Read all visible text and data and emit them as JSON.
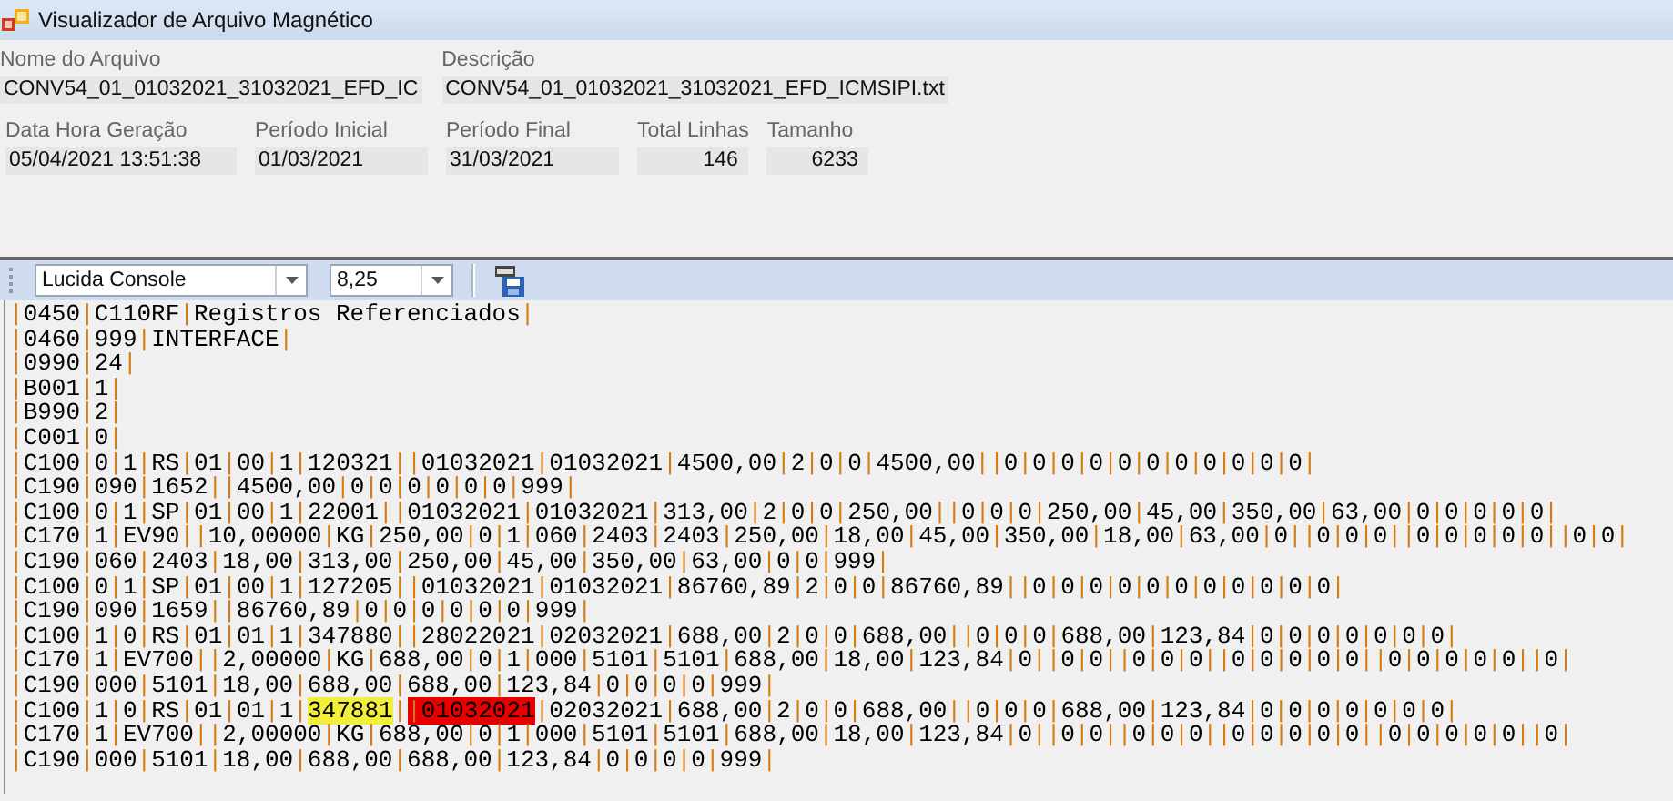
{
  "window": {
    "title": "Visualizador de Arquivo Magnético"
  },
  "file_fields": [
    {
      "label": "Nome do Arquivo",
      "value": "CONV54_01_01032021_31032021_EFD_IC"
    },
    {
      "label": "Descrição",
      "value": "CONV54_01_01032021_31032021_EFD_ICMSIPI.txt"
    }
  ],
  "summary_fields": [
    {
      "label": "Data Hora Geração",
      "value": "05/04/2021 13:51:38",
      "kind": "text"
    },
    {
      "label": "Período Inicial",
      "value": "01/03/2021",
      "kind": "text"
    },
    {
      "label": "Período Final",
      "value": "31/03/2021",
      "kind": "text"
    },
    {
      "label": "Total Linhas",
      "value": "146",
      "kind": "number"
    },
    {
      "label": "Tamanho",
      "value": "6233",
      "kind": "number"
    }
  ],
  "toolbar": {
    "font": "Lucida Console",
    "size": "8,25"
  },
  "lines": [
    {
      "segments": [
        {
          "text": "|0450|C110RF|Registros Referenciados|"
        }
      ]
    },
    {
      "segments": [
        {
          "text": "|0460|999|INTERFACE|"
        }
      ]
    },
    {
      "segments": [
        {
          "text": "|0990|24|"
        }
      ]
    },
    {
      "segments": [
        {
          "text": "|B001|1|"
        }
      ]
    },
    {
      "segments": [
        {
          "text": "|B990|2|"
        }
      ]
    },
    {
      "segments": [
        {
          "text": "|C001|0|"
        }
      ]
    },
    {
      "segments": [
        {
          "text": "|C100|0|1|RS|01|00|1|120321||01032021|01032021|4500,00|2|0|0|4500,00||0|0|0|0|0|0|0|0|0|0|0|"
        }
      ]
    },
    {
      "segments": [
        {
          "text": "|C190|090|1652||4500,00|0|0|0|0|0|0|999|"
        }
      ]
    },
    {
      "segments": [
        {
          "text": "|C100|0|1|SP|01|00|1|22001||01032021|01032021|313,00|2|0|0|250,00||0|0|0|250,00|45,00|350,00|63,00|0|0|0|0|0|"
        }
      ]
    },
    {
      "segments": [
        {
          "text": "|C170|1|EV90||10,00000|KG|250,00|0|1|060|2403|2403|250,00|18,00|45,00|350,00|18,00|63,00|0||0|0|0||0|0|0|0|0||0|0|"
        }
      ]
    },
    {
      "segments": [
        {
          "text": "|C190|060|2403|18,00|313,00|250,00|45,00|350,00|63,00|0|0|999|"
        }
      ]
    },
    {
      "segments": [
        {
          "text": "|C100|0|1|SP|01|00|1|127205||01032021|01032021|86760,89|2|0|0|86760,89||0|0|0|0|0|0|0|0|0|0|0|"
        }
      ]
    },
    {
      "segments": [
        {
          "text": "|C190|090|1659||86760,89|0|0|0|0|0|0|999|"
        }
      ]
    },
    {
      "segments": [
        {
          "text": "|C100|1|0|RS|01|01|1|347880||28022021|02032021|688,00|2|0|0|688,00||0|0|0|688,00|123,84|0|0|0|0|0|0|0|"
        }
      ]
    },
    {
      "segments": [
        {
          "text": "|C170|1|EV700||2,00000|KG|688,00|0|1|000|5101|5101|688,00|18,00|123,84|0||0|0||0|0|0||0|0|0|0|0||0|0|0|0|0||0|"
        }
      ]
    },
    {
      "segments": [
        {
          "text": "|C190|000|5101|18,00|688,00|688,00|123,84|0|0|0|0|999|"
        }
      ]
    },
    {
      "segments": [
        {
          "text": "|C100|1|0|RS|01|01|1|"
        },
        {
          "text": "347881",
          "color": "#f2ee3c"
        },
        {
          "text": "|"
        },
        {
          "text": "|01032021",
          "color": "#e80000"
        },
        {
          "text": "|02032021|688,00|2|0|0|688,00||0|0|0|688,00|123,84|0|0|0|0|0|0|0|"
        }
      ]
    },
    {
      "segments": [
        {
          "text": "|C170|1|EV700||2,00000|KG|688,00|0|1|000|5101|5101|688,00|18,00|123,84|0||0|0||0|0|0||0|0|0|0|0||0|0|0|0|0||0|"
        }
      ]
    },
    {
      "segments": [
        {
          "text": "|C190|000|5101|18,00|688,00|688,00|123,84|0|0|0|0|999|"
        }
      ]
    }
  ]
}
